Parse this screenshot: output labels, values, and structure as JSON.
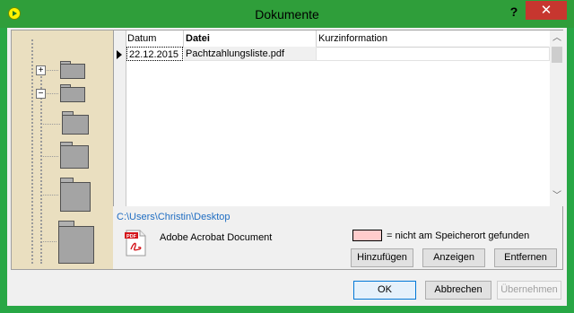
{
  "window": {
    "title": "Dokumente",
    "help": "?",
    "close": "✕",
    "accent_color": "#2f9e3a"
  },
  "table": {
    "columns": [
      "Datum",
      "Datei",
      "Kurzinformation"
    ],
    "rows": [
      {
        "datum": "22.12.2015",
        "datei": "Pachtzahlungsliste.pdf",
        "kurzinfo": ""
      }
    ]
  },
  "details": {
    "path": "C:\\Users\\Christin\\Desktop",
    "doc_type": "Adobe Acrobat Document",
    "legend_text": "= nicht am Speicherort gefunden",
    "legend_color": "#ffcccc",
    "pdf_icon_label": "PDF"
  },
  "buttons": {
    "add": "Hinzufügen",
    "show": "Anzeigen",
    "remove": "Entfernen",
    "ok": "OK",
    "cancel": "Abbrechen",
    "apply": "Übernehmen"
  },
  "sidebar": {
    "expand_symbol": "+",
    "collapse_symbol": "−"
  }
}
